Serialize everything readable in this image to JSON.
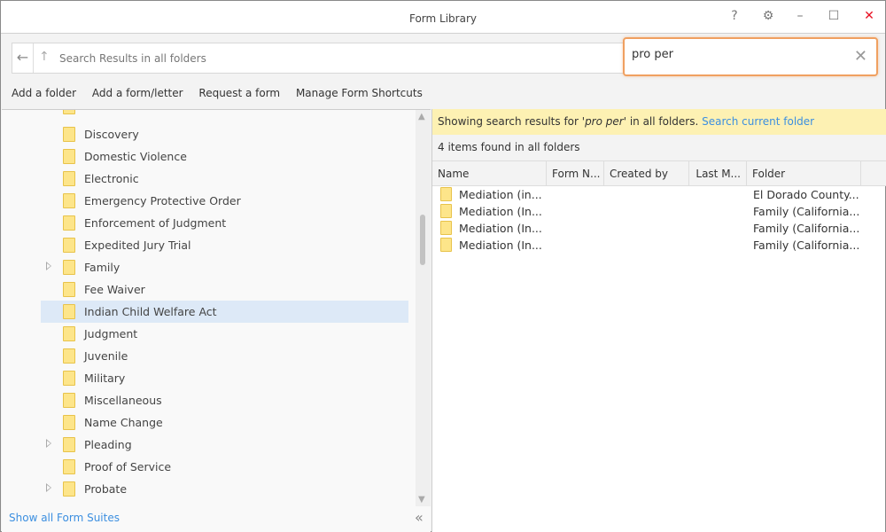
{
  "window": {
    "title": "Form Library",
    "help": "?",
    "settings_icon": "gear-icon",
    "minimize": "–",
    "maximize": "☐",
    "close": "✕"
  },
  "address": {
    "back": "←",
    "up": "↑",
    "path": "Search Results in all folders"
  },
  "search": {
    "value": "pro per",
    "clear": "✕"
  },
  "commands": [
    "Add a folder",
    "Add a form/letter",
    "Request a form",
    "Manage Form Shortcuts"
  ],
  "tree": {
    "items": [
      {
        "label": "Discovery",
        "expandable": false
      },
      {
        "label": "Domestic Violence",
        "expandable": false
      },
      {
        "label": "Electronic",
        "expandable": false
      },
      {
        "label": "Emergency Protective Order",
        "expandable": false
      },
      {
        "label": "Enforcement of Judgment",
        "expandable": false
      },
      {
        "label": "Expedited Jury Trial",
        "expandable": false
      },
      {
        "label": "Family",
        "expandable": true
      },
      {
        "label": "Fee Waiver",
        "expandable": false
      },
      {
        "label": "Indian Child Welfare Act",
        "expandable": false,
        "selected": true
      },
      {
        "label": "Judgment",
        "expandable": false
      },
      {
        "label": "Juvenile",
        "expandable": false
      },
      {
        "label": "Military",
        "expandable": false
      },
      {
        "label": "Miscellaneous",
        "expandable": false
      },
      {
        "label": "Name Change",
        "expandable": false
      },
      {
        "label": "Pleading",
        "expandable": true
      },
      {
        "label": "Proof of Service",
        "expandable": false
      },
      {
        "label": "Probate",
        "expandable": true
      }
    ],
    "show_all": "Show all Form Suites",
    "collapse": "«"
  },
  "results": {
    "banner_prefix": "Showing search results for '",
    "banner_query": "pro per",
    "banner_suffix": "' in all folders. ",
    "banner_link": "Search current folder",
    "count": "4 items found in all folders",
    "columns": [
      "Name",
      "Form N...",
      "Created by",
      "Last M...",
      "Folder"
    ],
    "rows": [
      {
        "name": "Mediation (in...",
        "folder": "El Dorado County..."
      },
      {
        "name": "Mediation (In...",
        "folder": "Family (California..."
      },
      {
        "name": "Mediation (In...",
        "folder": "Family (California..."
      },
      {
        "name": "Mediation (In...",
        "folder": "Family (California..."
      }
    ]
  },
  "colors": {
    "accent": "#3c8fe0",
    "search_border": "#f0a060",
    "banner": "#fdf1b3",
    "selection": "#dde9f7",
    "close": "#e81123"
  }
}
